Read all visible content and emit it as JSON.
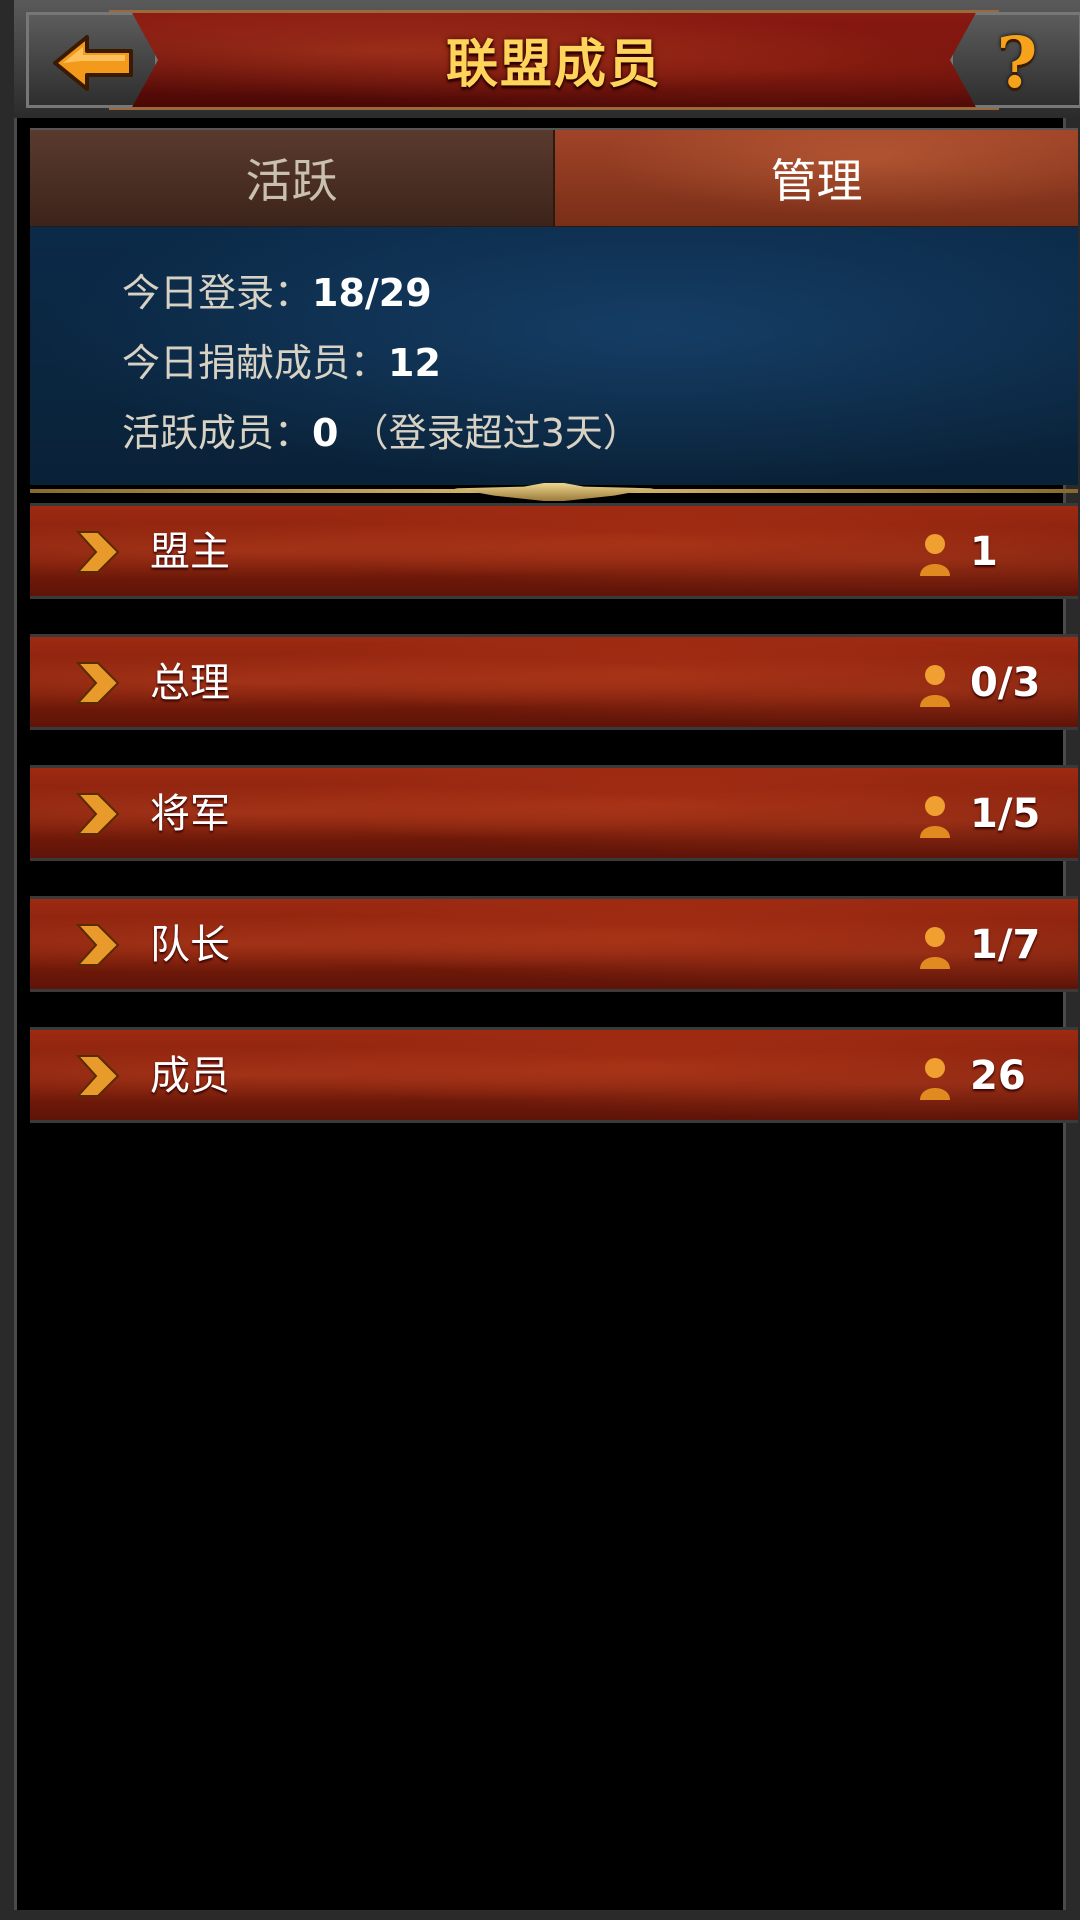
{
  "header": {
    "title": "联盟成员",
    "back_icon": "back-arrow-icon",
    "help_icon": "help-icon",
    "help_glyph": "?"
  },
  "tabs": [
    {
      "label": "活跃",
      "active": false
    },
    {
      "label": "管理",
      "active": true
    }
  ],
  "stats": {
    "login_label": "今日登录：",
    "login_value": "18/29",
    "donate_label": "今日捐献成员：",
    "donate_value": "12",
    "active_label": "活跃成员：",
    "active_value": "0",
    "active_note": "（登录超过3天）"
  },
  "ranks": [
    {
      "label": "盟主",
      "count": "1"
    },
    {
      "label": "总理",
      "count": "0/3"
    },
    {
      "label": "将军",
      "count": "1/5"
    },
    {
      "label": "队长",
      "count": "1/7"
    },
    {
      "label": "成员",
      "count": "26"
    }
  ],
  "colors": {
    "title": "#ffd45a",
    "accent_orange": "#f6a21a",
    "panel_blue": "#0b2a48",
    "row_red": "#9e2a12"
  }
}
